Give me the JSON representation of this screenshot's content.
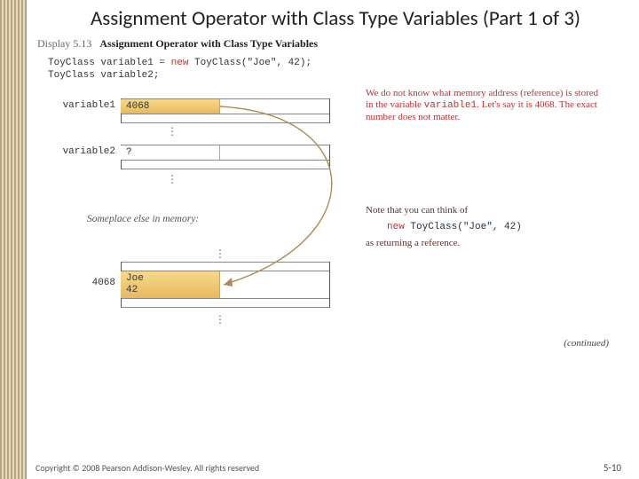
{
  "slide": {
    "title": "Assignment Operator with Class Type Variables (Part 1 of 3)"
  },
  "display": {
    "label": "Display 5.13",
    "caption": "Assignment Operator with Class Type Variables"
  },
  "code": {
    "line1_a": "ToyClass variable1 = ",
    "line1_kw": "new",
    "line1_b": " ToyClass(\"Joe\", 42);",
    "line2": "ToyClass variable2;"
  },
  "memory": {
    "var1_label": "variable1",
    "var1_value": "4068",
    "var2_label": "variable2",
    "var2_value": "?",
    "someplace": "Someplace else in memory:",
    "obj_addr": "4068",
    "obj_field1": "Joe",
    "obj_field2": "42"
  },
  "annotations": {
    "note1_a": "We do not know what memory address (reference) is stored in the variable ",
    "note1_var": "variable1",
    "note1_b": ". Let's say it is 4068. The exact number does not matter.",
    "note2_a": "Note that you can think of",
    "note2_call_kw": "new",
    "note2_call_rest": " ToyClass(\"Joe\", 42)",
    "note2_b": "as returning a reference.",
    "continued": "(continued)"
  },
  "footer": {
    "copyright": "Copyright © 2008 Pearson Addison-Wesley. All rights reserved",
    "page": "5-10"
  }
}
